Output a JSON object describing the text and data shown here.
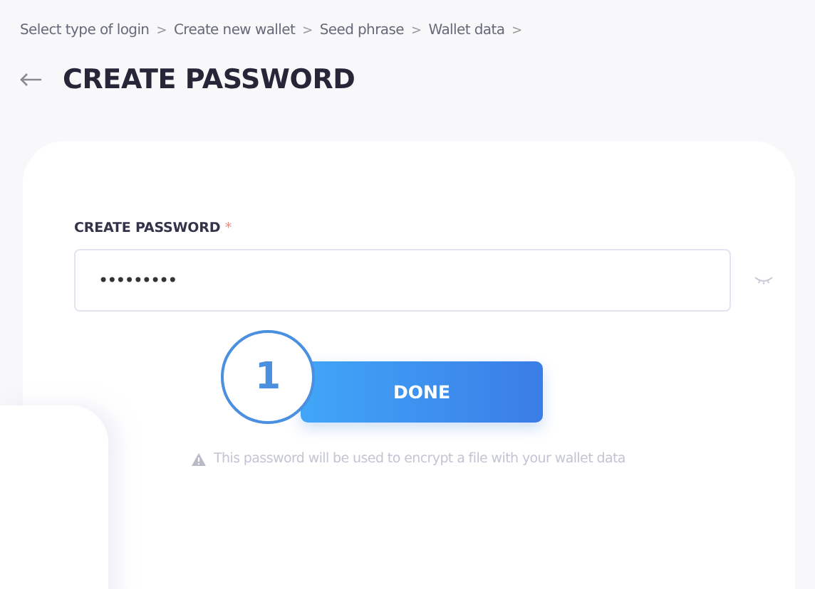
{
  "breadcrumbs": [
    "Select type of login",
    "Create new wallet",
    "Seed phrase",
    "Wallet data"
  ],
  "breadcrumb_separator": ">",
  "title": "CREATE PASSWORD",
  "form": {
    "label": "CREATE PASSWORD",
    "required_mark": "*",
    "value": "•••••••••",
    "button": "DONE",
    "note": "This password will be used to encrypt a file with your wallet data"
  },
  "callout": "1"
}
